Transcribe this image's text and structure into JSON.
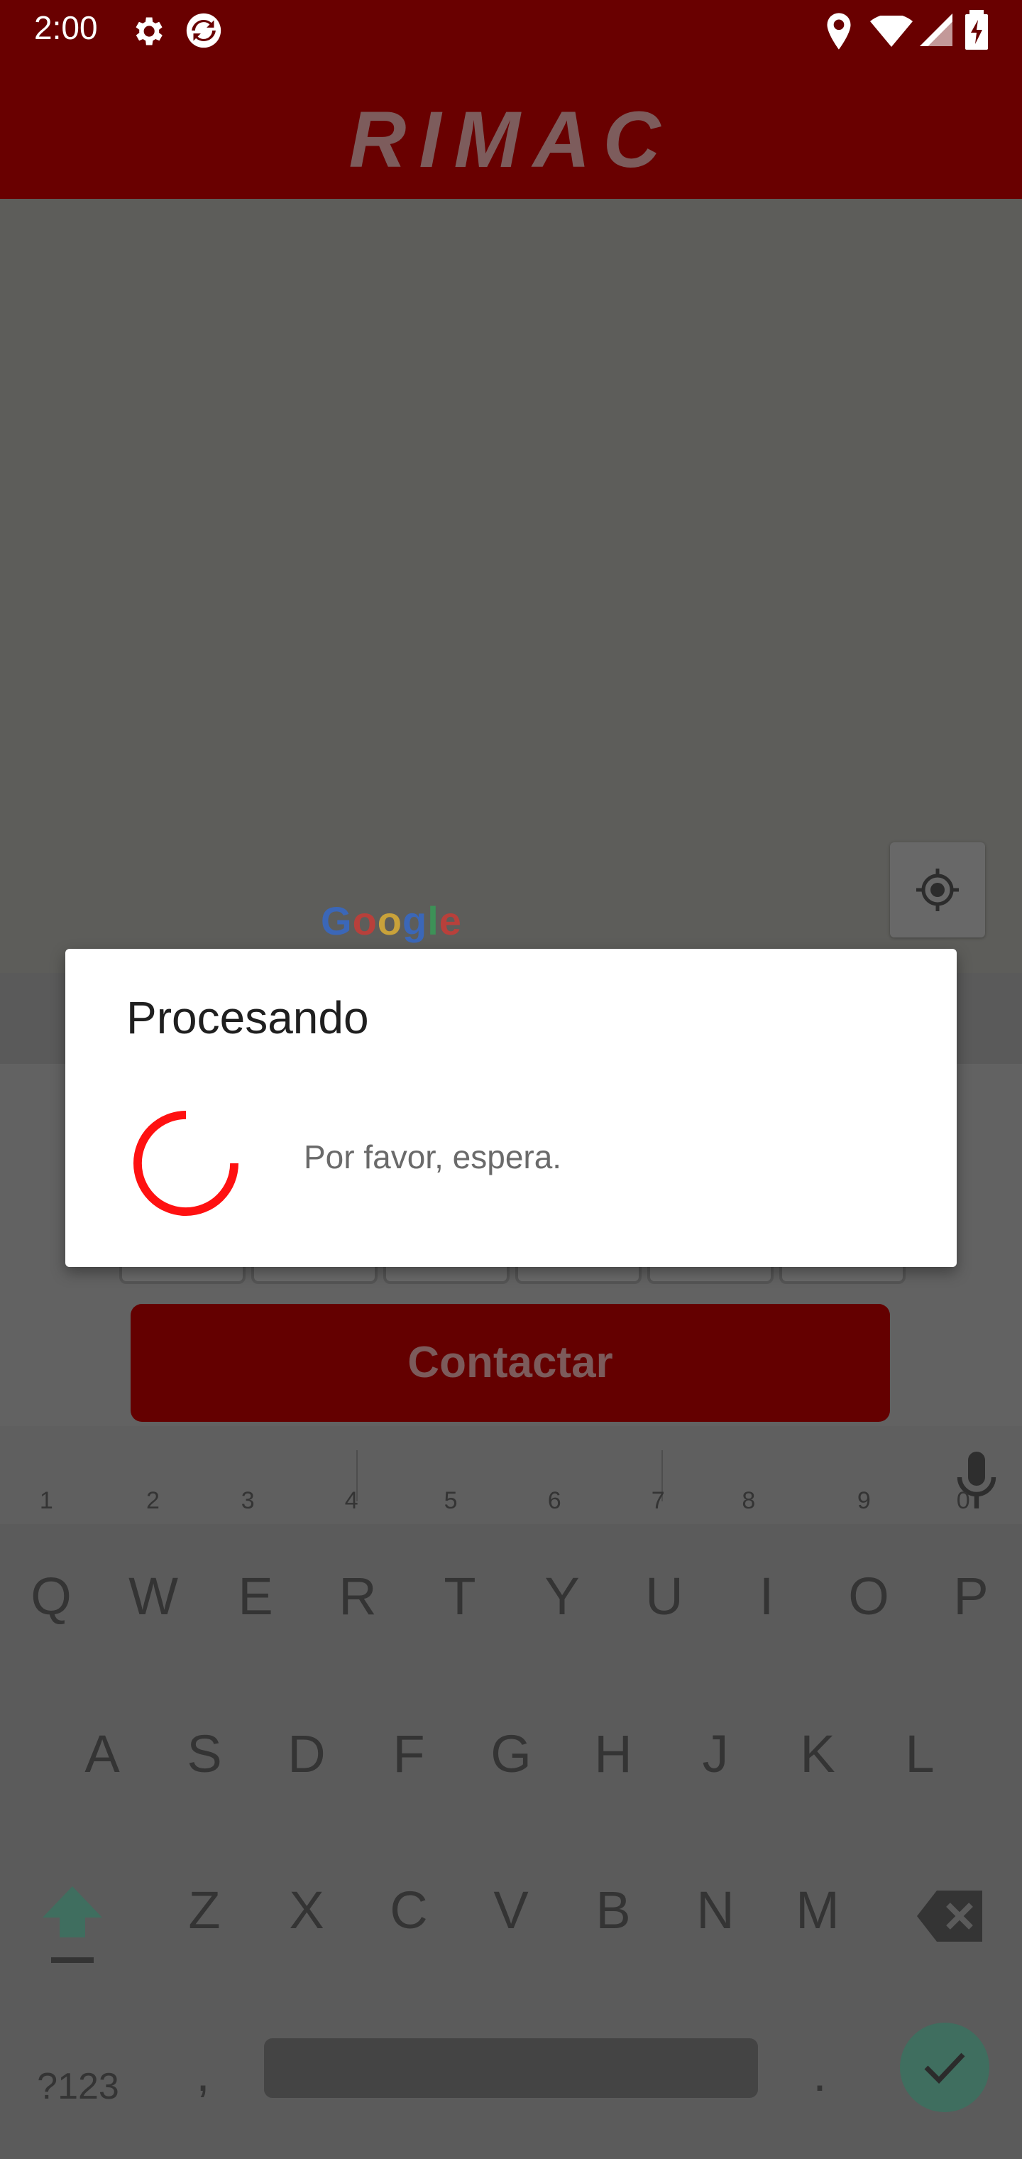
{
  "status_bar": {
    "time": "2:00"
  },
  "app": {
    "logo_text": "RIMAC"
  },
  "map": {
    "google_logo": "Google"
  },
  "form": {
    "contact_button_label": "Contactar"
  },
  "dialog": {
    "title": "Procesando",
    "message": "Por favor, espera."
  },
  "keyboard": {
    "row1": [
      {
        "k": "Q",
        "h": "1"
      },
      {
        "k": "W",
        "h": "2"
      },
      {
        "k": "E",
        "h": "3"
      },
      {
        "k": "R",
        "h": "4"
      },
      {
        "k": "T",
        "h": "5"
      },
      {
        "k": "Y",
        "h": "6"
      },
      {
        "k": "U",
        "h": "7"
      },
      {
        "k": "I",
        "h": "8"
      },
      {
        "k": "O",
        "h": "9"
      },
      {
        "k": "P",
        "h": "0"
      }
    ],
    "row2": [
      "A",
      "S",
      "D",
      "F",
      "G",
      "H",
      "J",
      "K",
      "L"
    ],
    "row3": [
      "Z",
      "X",
      "C",
      "V",
      "B",
      "N",
      "M"
    ],
    "symbols_label": "?123",
    "comma": ",",
    "period": "."
  },
  "colors": {
    "brand_red": "#690000",
    "spinner_red": "#ff1111",
    "enter_green": "#3f6e5f"
  }
}
